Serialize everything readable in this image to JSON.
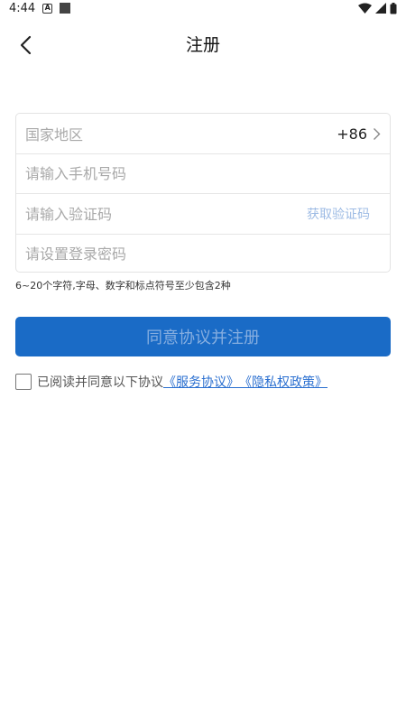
{
  "status_bar": {
    "time": "4:44",
    "icons": [
      "a-notification-icon",
      "square-notification-icon",
      "wifi-icon",
      "signal-icon",
      "battery-icon"
    ]
  },
  "nav": {
    "title": "注册",
    "back_icon": "chevron-left-icon"
  },
  "form": {
    "country_label": "国家地区",
    "country_code": "+86",
    "phone_placeholder": "请输入手机号码",
    "code_placeholder": "请输入验证码",
    "get_code_label": "获取验证码",
    "password_placeholder": "请设置登录密码"
  },
  "hint": "6~20个字符,字母、数字和标点符号至少包含2种",
  "submit_label": "同意协议并注册",
  "agreement": {
    "prefix": "已阅读并同意以下协议",
    "service_link": "《服务协议》",
    "privacy_link": "《隐私权政策》"
  },
  "colors": {
    "primary": "#1a6bc6",
    "link": "#2a6fd0",
    "placeholder": "#a9a9a9"
  }
}
